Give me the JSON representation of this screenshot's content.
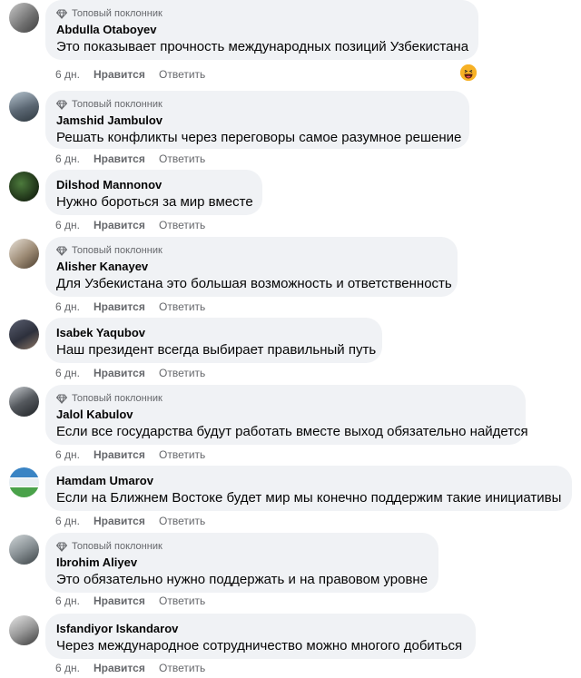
{
  "labels": {
    "badge": "Топовый поклонник",
    "like": "Нравится",
    "reply": "Ответить"
  },
  "comments": [
    {
      "author": "Abdulla Otaboyev",
      "text": "Это показывает прочность международных позиций Узбекистана",
      "time": "6 дн.",
      "top_fan": true,
      "reaction": "haha"
    },
    {
      "author": "Jamshid Jambulov",
      "text": "Решать конфликты через переговоры самое разумное решение",
      "time": "6 дн.",
      "top_fan": true
    },
    {
      "author": "Dilshod Mannonov",
      "text": "Нужно бороться за мир вместе",
      "time": "6 дн.",
      "top_fan": false
    },
    {
      "author": "Alisher Kanayev",
      "text": "Для Узбекистана это большая возможность и ответственность",
      "time": "6 дн.",
      "top_fan": true
    },
    {
      "author": "Isabek Yaqubov",
      "text": "Наш президент всегда выбирает правильный путь",
      "time": "6 дн.",
      "top_fan": false
    },
    {
      "author": "Jalol Kabulov",
      "text": "Если все государства будут работать вместе выход обязательно найдется",
      "time": "6 дн.",
      "top_fan": true
    },
    {
      "author": "Hamdam Umarov",
      "text": "Если на Ближнем Востоке будет мир мы конечно поддержим такие инициативы",
      "time": "6 дн.",
      "top_fan": false
    },
    {
      "author": "Ibrohim Aliyev",
      "text": "Это обязательно нужно поддержать и на правовом уровне",
      "time": "6 дн.",
      "top_fan": true
    },
    {
      "author": "Isfandiyor Iskandarov",
      "text": "Через международное сотрудничество можно многого добиться",
      "time": "6 дн.",
      "top_fan": false
    }
  ],
  "colors": {
    "bubble": "#f0f2f5",
    "meta": "#65676b",
    "text": "#050505"
  }
}
